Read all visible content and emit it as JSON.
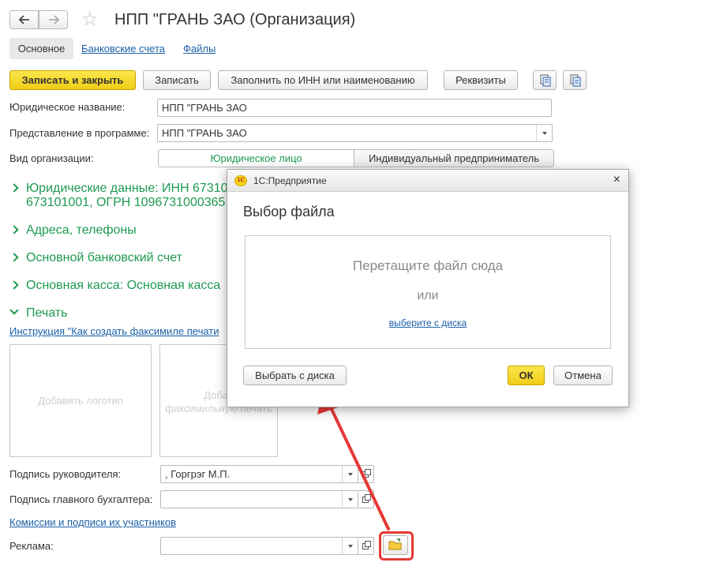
{
  "window": {
    "title": "НПП \"ГРАНЬ ЗАО (Организация)",
    "back_icon": "arrow-left-icon",
    "forward_icon": "arrow-right-icon",
    "favorite_icon": "star-icon"
  },
  "tabs": [
    {
      "label": "Основное",
      "active": true
    },
    {
      "label": "Банковские счета",
      "active": false
    },
    {
      "label": "Файлы",
      "active": false
    }
  ],
  "toolbar": {
    "save_close": "Записать и закрыть",
    "save": "Записать",
    "fill_by_inn": "Заполнить по ИНН или наименованию",
    "requisites": "Реквизиты"
  },
  "form": {
    "legal_name_label": "Юридическое название:",
    "legal_name_value": "НПП \"ГРАНЬ ЗАО",
    "display_name_label": "Представление в программе:",
    "display_name_value": "НПП \"ГРАНЬ ЗАО",
    "org_type_label": "Вид организации:",
    "org_type_options": [
      "Юридическое лицо",
      "Индивидуальный предприниматель"
    ],
    "org_type_selected": "Юридическое лицо"
  },
  "groups": {
    "legal_data_line1": "Юридические данные: ИНН 67310",
    "legal_data_line2": "673101001, ОГРН 1096731000365",
    "addresses": "Адреса, телефоны",
    "bank_account": "Основной банковский счет",
    "cash_desk": "Основная касса: Основная касса",
    "print": "Печать"
  },
  "print": {
    "instruction_link": "Инструкция \"Как создать факсимиле печати",
    "add_logo": "Добавить логотип",
    "add_facsimile_line1": "Добав",
    "add_facsimile_line2": "факсимильную печать"
  },
  "signatures": {
    "head_label": "Подпись руководителя:",
    "head_value": ", Горгрэг М.П.",
    "accountant_label": "Подпись главного бухгалтера:",
    "accountant_value": "",
    "commissions_link": "Комиссии и подписи их участников",
    "ads_label": "Реклама:",
    "ads_value": ""
  },
  "dialog": {
    "app_title": "1С:Предприятие",
    "logo_text": "1С",
    "title": "Выбор файла",
    "drop_hint": "Перетащите файл сюда",
    "or": "или",
    "choose_link": "выберите с диска",
    "choose_button": "Выбрать с диска",
    "ok": "ОК",
    "cancel": "Отмена",
    "close": "×"
  },
  "colors": {
    "accent_green": "#1e9a52",
    "link_blue": "#1b5fa7",
    "primary_yellow": "#f5d52a",
    "annotation_red": "#e53935"
  }
}
